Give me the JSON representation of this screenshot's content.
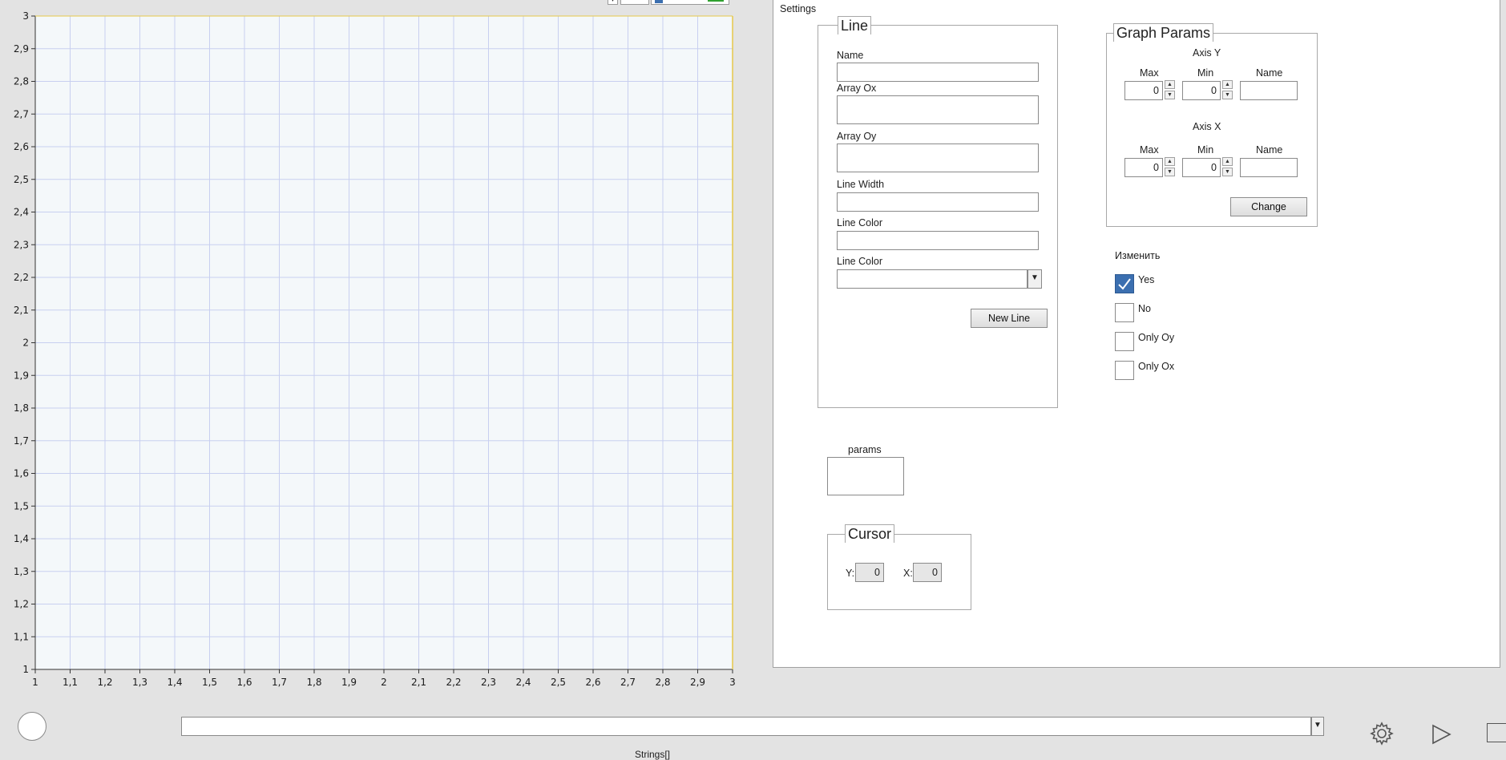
{
  "chart_data": {
    "type": "line",
    "series": [],
    "x": {
      "min": 1,
      "max": 3,
      "ticks": [
        "1",
        "1,1",
        "1,2",
        "1,3",
        "1,4",
        "1,5",
        "1,6",
        "1,7",
        "1,8",
        "1,9",
        "2",
        "2,1",
        "2,2",
        "2,3",
        "2,4",
        "2,5",
        "2,6",
        "2,7",
        "2,8",
        "2,9",
        "3"
      ]
    },
    "y": {
      "min": 1,
      "max": 3,
      "ticks": [
        "1",
        "1,1",
        "1,2",
        "1,3",
        "1,4",
        "1,5",
        "1,6",
        "1,7",
        "1,8",
        "1,9",
        "2",
        "2,1",
        "2,2",
        "2,3",
        "2,4",
        "2,5",
        "2,6",
        "2,7",
        "2,8",
        "2,9",
        "3"
      ]
    },
    "grid": true,
    "colors": {
      "plot_bg": "#f4f8fa",
      "grid": "#c8cff0",
      "frame_right": "#e6c84a",
      "axis": "#333333"
    }
  },
  "settings": {
    "title": "Settings",
    "line_group": {
      "title": "Line",
      "name_label": "Name",
      "name_value": "",
      "array_ox_label": "Array Ox",
      "array_ox_value": "",
      "array_oy_label": "Array Oy",
      "array_oy_value": "",
      "line_width_label": "Line Width",
      "line_width_value": "",
      "line_color_label": "Line Color",
      "line_color_value": "",
      "line_color_select_label": "Line Color",
      "line_color_select_value": "",
      "new_line_button": "New Line"
    },
    "graph_params": {
      "title": "Graph Params",
      "axis_y": {
        "title": "Axis Y",
        "max_label": "Max",
        "min_label": "Min",
        "name_label": "Name",
        "max_value": "0",
        "min_value": "0",
        "name_value": ""
      },
      "axis_x": {
        "title": "Axis X",
        "max_label": "Max",
        "min_label": "Min",
        "name_label": "Name",
        "max_value": "0",
        "min_value": "0",
        "name_value": ""
      },
      "change_button": "Change"
    },
    "change_mode": {
      "label": "Изменить",
      "options": [
        {
          "label": "Yes",
          "checked": true
        },
        {
          "label": "No",
          "checked": false
        },
        {
          "label": "Only Oy",
          "checked": false
        },
        {
          "label": "Only Ox",
          "checked": false
        }
      ]
    },
    "params": {
      "label": "params",
      "value": ""
    },
    "cursor": {
      "title": "Cursor",
      "y_label": "Y:",
      "y_value": "0",
      "x_label": "X:",
      "x_value": "0"
    }
  },
  "bottom": {
    "strings_label": "Strings[]",
    "combo_value": "",
    "icons": [
      "circle-indicator",
      "gear-icon",
      "run-arrow-icon",
      "stop-icon"
    ]
  },
  "colors": {
    "check_blue": "#3b6fb0",
    "plot_frame_yellow": "#e6c84a"
  }
}
